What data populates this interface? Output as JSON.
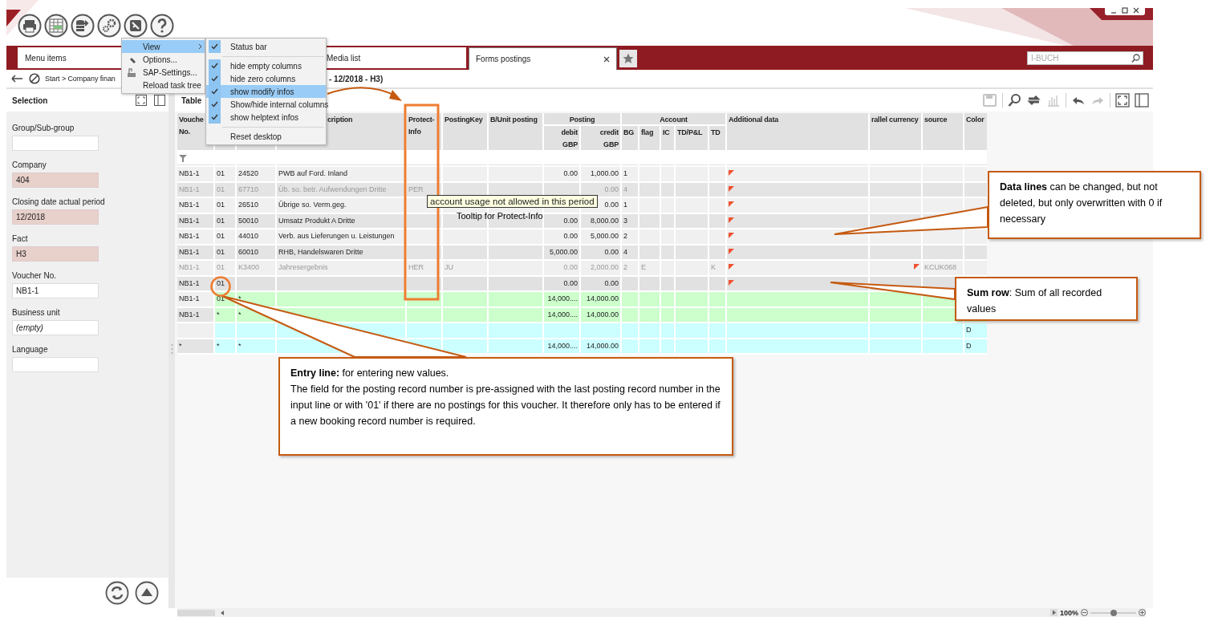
{
  "header_toolbar": [
    {
      "kind": "print"
    },
    {
      "kind": "table"
    },
    {
      "kind": "export"
    },
    {
      "kind": "settings"
    },
    {
      "kind": "tools"
    },
    {
      "kind": "help"
    }
  ],
  "window_controls": [
    {
      "kind": "minimize"
    },
    {
      "kind": "maximize"
    },
    {
      "kind": "close"
    }
  ],
  "tabs": [
    {
      "label": "Menu items",
      "selected": false,
      "closable": false
    },
    {
      "label": "Media list",
      "selected": false,
      "closable": false
    },
    {
      "label": "Forms postings",
      "selected": true,
      "closable": true
    }
  ],
  "search": {
    "placeholder": "I-BUCH"
  },
  "breadcrumb": {
    "start": "Start > Company finan",
    "end": "- 12/2018 - H3)"
  },
  "selection": {
    "title": "Selection",
    "fields": [
      {
        "label": "Group/Sub-group",
        "locked": false
      },
      {
        "label": "Company",
        "value": "404",
        "locked": true
      },
      {
        "label": "Closing date actual period",
        "value": "12/2018",
        "locked": true
      },
      {
        "label": "Fact",
        "value": "H3",
        "locked": true
      },
      {
        "label": "Voucher No.",
        "value": "NB1-1",
        "locked": false
      },
      {
        "label": "Business unit",
        "placeholder": "(empty)",
        "locked": false
      },
      {
        "label": "Language",
        "locked": false
      }
    ]
  },
  "table": {
    "title": "Table",
    "toolbar": [
      {
        "kind": "save",
        "disabled": true
      },
      {
        "kind": "search",
        "disabled": false
      },
      {
        "kind": "refresh",
        "disabled": false
      },
      {
        "kind": "chart",
        "disabled": true
      },
      {
        "kind": "undo",
        "disabled": false
      },
      {
        "kind": "redo",
        "disabled": true
      },
      {
        "kind": "maximize",
        "disabled": false
      },
      {
        "kind": "panel",
        "disabled": false
      }
    ],
    "header": [
      {
        "kind": "column",
        "lines": [
          "Vouche",
          "No."
        ]
      },
      {
        "kind": "column"
      },
      {
        "kind": "column"
      },
      {
        "kind": "column",
        "lines": [
          "cription"
        ]
      },
      {
        "kind": "column",
        "lines": [
          "Protect-",
          "Info"
        ]
      },
      {
        "kind": "column",
        "lines": [
          "PostingKey"
        ]
      },
      {
        "kind": "column",
        "lines": [
          "B/Unit posting"
        ]
      },
      {
        "kind": "group",
        "label": "Posting",
        "columns": [
          {
            "lines": [
              "debit",
              "GBP"
            ]
          },
          {
            "lines": [
              "credit",
              "GBP"
            ]
          }
        ]
      },
      {
        "kind": "group",
        "label": "Account",
        "columns": [
          {
            "lines": [
              "BG"
            ]
          },
          {
            "lines": [
              "flag"
            ]
          },
          {
            "lines": [
              "IC"
            ]
          },
          {
            "lines": [
              "TD/P&L"
            ]
          },
          {
            "lines": [
              "TD"
            ]
          }
        ]
      },
      {
        "kind": "column",
        "lines": [
          "Additional data"
        ]
      },
      {
        "kind": "column",
        "lines": [
          "rallel currency"
        ]
      },
      {
        "kind": "column",
        "lines": [
          "source"
        ]
      },
      {
        "kind": "column",
        "lines": [
          "Color"
        ]
      }
    ],
    "rows": [
      {
        "kind": "data",
        "cells": {
          "voucher": "NB1-1",
          "record_no": "01",
          "account": "24520",
          "description": "PWB auf Ford. Inland",
          "debit": "0.00",
          "credit": "1,000.00",
          "bg": "1"
        },
        "additional_data_marked": true,
        "parallel_currency_marked": false
      },
      {
        "kind": "locked",
        "cells": {
          "voucher": "NB1-1",
          "record_no": "01",
          "account": "67710",
          "description": "Üb. so. betr. Aufwendungen Dritte",
          "protect_info": "PER",
          "credit": "0.00",
          "bg": "4"
        },
        "additional_data_marked": true,
        "parallel_currency_marked": false
      },
      {
        "kind": "data",
        "cells": {
          "voucher": "NB1-1",
          "record_no": "01",
          "account": "26510",
          "description": "Übrige so. Verm.geg.",
          "credit": "0.00",
          "bg": "1"
        },
        "additional_data_marked": true,
        "parallel_currency_marked": false
      },
      {
        "kind": "data",
        "cells": {
          "voucher": "NB1-1",
          "record_no": "01",
          "account": "50010",
          "description": "Umsatz Produkt A Dritte",
          "debit": "0.00",
          "credit": "8,000.00",
          "bg": "3"
        },
        "additional_data_marked": true,
        "parallel_currency_marked": false
      },
      {
        "kind": "data",
        "cells": {
          "voucher": "NB1-1",
          "record_no": "01",
          "account": "44010",
          "description": "Verb. aus Lieferungen u. Leistungen",
          "debit": "0.00",
          "credit": "5,000.00",
          "bg": "2"
        },
        "additional_data_marked": true,
        "parallel_currency_marked": false
      },
      {
        "kind": "data",
        "cells": {
          "voucher": "NB1-1",
          "record_no": "01",
          "account": "60010",
          "description": "RHB, Handelswaren Dritte",
          "debit": "5,000.00",
          "credit": "0.00",
          "bg": "4"
        },
        "additional_data_marked": true,
        "parallel_currency_marked": false
      },
      {
        "kind": "locked",
        "cells": {
          "voucher": "NB1-1",
          "record_no": "01",
          "account": "K3400",
          "description": "Jahresergebnis",
          "protect_info": "HER",
          "posting_key": "JU",
          "debit": "0.00",
          "credit": "2,000.00",
          "bg": "2",
          "flag": "E",
          "td": "K",
          "source": "KCUK068"
        },
        "additional_data_marked": true,
        "parallel_currency_marked": true
      },
      {
        "kind": "entry",
        "cells": {
          "voucher": "NB1-1",
          "record_no": "01",
          "debit": "0.00",
          "credit": "0.00"
        },
        "additional_data_marked": true,
        "parallel_currency_marked": false
      },
      {
        "kind": "sum",
        "cells": {
          "voucher": "NB1-1",
          "record_no": "01",
          "account": "*",
          "debit": "14,000....",
          "credit": "14,000.00"
        },
        "additional_data_marked": false,
        "parallel_currency_marked": false
      },
      {
        "kind": "sum",
        "cells": {
          "voucher": "NB1-1",
          "record_no": "*",
          "account": "*",
          "debit": "14,000....",
          "credit": "14,000.00"
        },
        "additional_data_marked": false,
        "parallel_currency_marked": false
      },
      {
        "kind": "total",
        "cells": {
          "color_column": "D"
        },
        "additional_data_marked": false,
        "parallel_currency_marked": false
      },
      {
        "kind": "total",
        "cells": {
          "voucher": "*",
          "record_no": "*",
          "account": "*",
          "debit": "14,000....",
          "credit": "14,000.00",
          "color_column": "D"
        },
        "additional_data_marked": false,
        "parallel_currency_marked": false
      }
    ]
  },
  "context_menu": {
    "items": [
      {
        "kind": "submenu",
        "label": "View",
        "selected": true
      },
      {
        "kind": "wrench",
        "label": "Options...",
        "selected": false
      },
      {
        "kind": "sap",
        "label": "SAP-Settings...",
        "selected": false
      },
      {
        "kind": "plain",
        "label": "Reload task tree",
        "selected": false
      }
    ],
    "submenu": [
      {
        "kind": "check",
        "label": "Status bar",
        "checked": true,
        "selected": false
      },
      {
        "kind": "separator"
      },
      {
        "kind": "check",
        "label": "hide empty columns",
        "checked": true,
        "selected": false
      },
      {
        "kind": "check",
        "label": "hide zero columns",
        "checked": true,
        "selected": false
      },
      {
        "kind": "check",
        "label": "show modify infos",
        "checked": true,
        "selected": true
      },
      {
        "kind": "check",
        "label": "Show/hide internal columns",
        "checked": true,
        "selected": false
      },
      {
        "kind": "check",
        "label": "show helptext infos",
        "checked": true,
        "selected": false
      },
      {
        "kind": "separator"
      },
      {
        "kind": "check",
        "label": "Reset desktop",
        "checked": false,
        "selected": false
      }
    ]
  },
  "tooltip": {
    "text": "account usage not allowed in this period",
    "caption": "Tooltip for Protect-Info"
  },
  "callouts": [
    {
      "kind": "data_lines",
      "text": "**Data lines** can be changed, but not deleted, but only overwritten with 0 if necessary"
    },
    {
      "kind": "sum_row",
      "text": "**Sum row**: Sum of all recorded values"
    },
    {
      "kind": "entry_line",
      "title": "**Entry line:** for entering new values.",
      "text": "The field for the posting record number is pre-assigned with the last posting record number in the input line or with '01' if there are no postings for this voucher. It therefore only has to be entered if a new booking record number is required."
    }
  ],
  "status_bar": {
    "zoom": "100%",
    "level": 0.5
  }
}
